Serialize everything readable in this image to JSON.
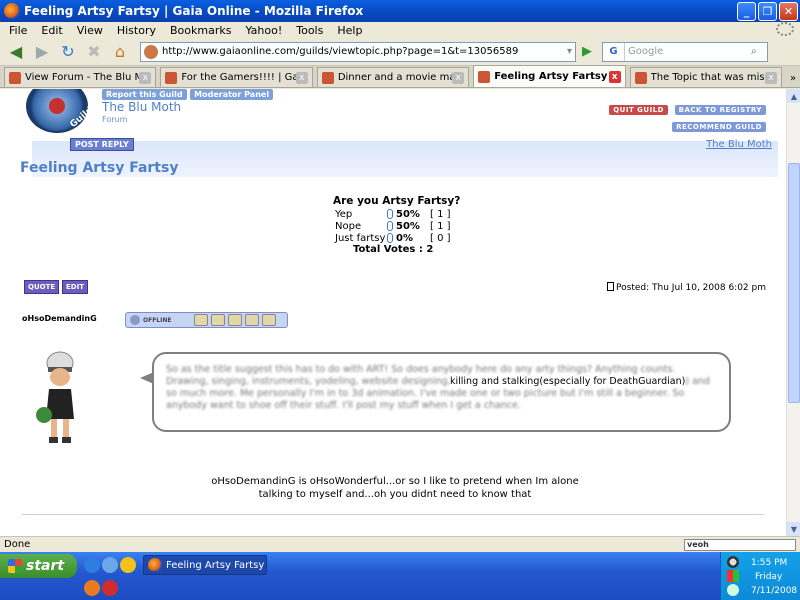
{
  "window": {
    "title": "Feeling Artsy Fartsy | Gaia Online - Mozilla Firefox"
  },
  "menu": [
    "File",
    "Edit",
    "View",
    "History",
    "Bookmarks",
    "Yahoo!",
    "Tools",
    "Help"
  ],
  "nav": {
    "url": "http://www.gaiaonline.com/guilds/viewtopic.php?page=1&t=13056589",
    "search_placeholder": "Google"
  },
  "tabs": [
    {
      "label": "View Forum - The Blu Moth |..."
    },
    {
      "label": "For the Gamers!!!! | Gaia O..."
    },
    {
      "label": "Dinner and a movie mate?....."
    },
    {
      "label": "Feeling Artsy Fartsy | G..."
    },
    {
      "label": "The Topic that was missing...."
    }
  ],
  "guild": {
    "logo_text": "Guilds",
    "report_link": "Report this Guild",
    "moderator_link": "Moderator Panel",
    "name": "The Blu Moth",
    "subtitle": "Forum",
    "quit": "QUIT GUILD",
    "back": "BACK TO REGISTRY",
    "recommend": "RECOMMEND GUILD",
    "post_reply": "POST REPLY",
    "header_link": "The Blu Moth"
  },
  "topic": {
    "title": "Feeling Artsy Fartsy"
  },
  "poll": {
    "question": "Are you Artsy Fartsy?",
    "options": [
      {
        "label": "Yep",
        "percent": "50%",
        "count": "[ 1 ]"
      },
      {
        "label": "Nope",
        "percent": "50%",
        "count": "[ 1 ]"
      },
      {
        "label": "Just fartsy",
        "percent": "0%",
        "count": "[ 0 ]"
      }
    ],
    "total": "Total Votes : 2"
  },
  "post": {
    "quote": "QUOTE",
    "edit": "EDIT",
    "posted": "Posted: Thu Jul 10, 2008 6:02 pm",
    "username": "oHsoDemandinG",
    "status": "OFFLINE",
    "body": "So as the title suggest this has to do with ART! So does anybody here do any arty things? Anything counts. Drawing, singing, instruments, yodeling, website designing, killing and stalking(especially for DeathGuardian) and so much more. Me personally I'm in to 3d animation. I've made one or two picture but I'm still a beginner. So anybody want to shoe off their stuff. I'll post my stuff when I get a chance.",
    "body_clear": "killing and stalking(especially for DeathGuardian)",
    "signature_line1": "oHsoDemandinG is oHsoWonderful...or so I like to pretend when Im alone",
    "signature_line2": "talking to myself and...oh you didnt need to know that"
  },
  "status": {
    "text": "Done",
    "veoh": "veoh"
  },
  "taskbar": {
    "start": "start",
    "task_label": "Feeling Artsy Fartsy |...",
    "time": "1:55 PM",
    "day": "Friday",
    "date": "7/11/2008"
  }
}
